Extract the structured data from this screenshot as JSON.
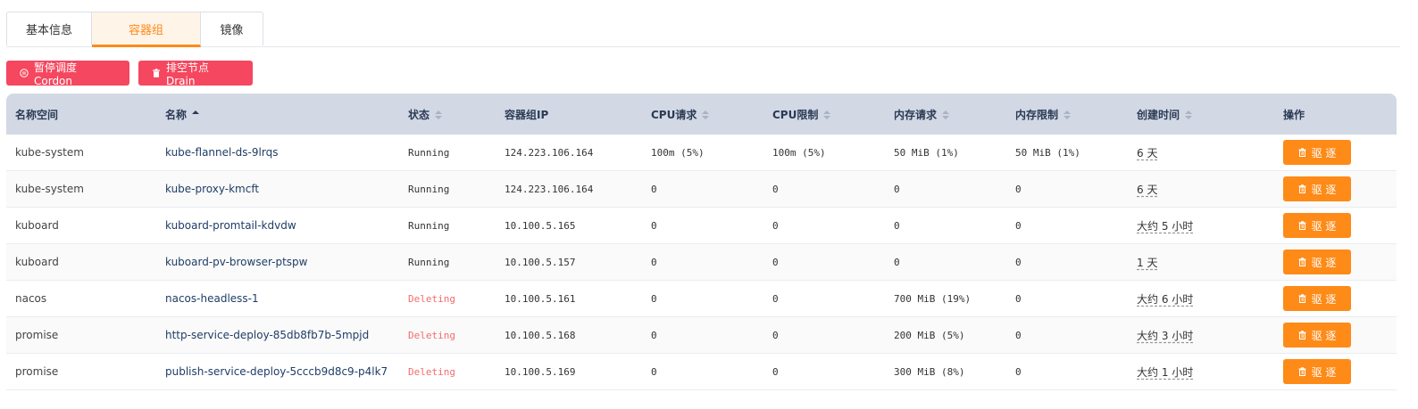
{
  "tabs": [
    "基本信息",
    "容器组",
    "镜像"
  ],
  "actions": {
    "cordon_label": "暂停调度 Cordon",
    "drain_label": "排空节点 Drain"
  },
  "colors": {
    "accent": "#fe8a18",
    "danger": "#f5475f",
    "header_bg": "#d2d9e5"
  },
  "table": {
    "headers": [
      "名称空间",
      "名称",
      "状态",
      "容器组IP",
      "CPU请求",
      "CPU限制",
      "内存请求",
      "内存限制",
      "创建时间",
      "操作"
    ],
    "evict_label": "驱 逐",
    "rows": [
      {
        "ns": "kube-system",
        "name": "kube-flannel-ds-9lrqs",
        "status": "Running",
        "ip": "124.223.106.164",
        "cpu_req": "100m (5%)",
        "cpu_lim": "100m (5%)",
        "mem_req": "50 MiB (1%)",
        "mem_lim": "50 MiB (1%)",
        "created": "6 天"
      },
      {
        "ns": "kube-system",
        "name": "kube-proxy-kmcft",
        "status": "Running",
        "ip": "124.223.106.164",
        "cpu_req": "0",
        "cpu_lim": "0",
        "mem_req": "0",
        "mem_lim": "0",
        "created": "6 天"
      },
      {
        "ns": "kuboard",
        "name": "kuboard-promtail-kdvdw",
        "status": "Running",
        "ip": "10.100.5.165",
        "cpu_req": "0",
        "cpu_lim": "0",
        "mem_req": "0",
        "mem_lim": "0",
        "created": "大约 5 小时"
      },
      {
        "ns": "kuboard",
        "name": "kuboard-pv-browser-ptspw",
        "status": "Running",
        "ip": "10.100.5.157",
        "cpu_req": "0",
        "cpu_lim": "0",
        "mem_req": "0",
        "mem_lim": "0",
        "created": "1 天"
      },
      {
        "ns": "nacos",
        "name": "nacos-headless-1",
        "status": "Deleting",
        "ip": "10.100.5.161",
        "cpu_req": "0",
        "cpu_lim": "0",
        "mem_req": "700 MiB (19%)",
        "mem_lim": "0",
        "created": "大约 6 小时"
      },
      {
        "ns": "promise",
        "name": "http-service-deploy-85db8fb7b-5mpjd",
        "status": "Deleting",
        "ip": "10.100.5.168",
        "cpu_req": "0",
        "cpu_lim": "0",
        "mem_req": "200 MiB (5%)",
        "mem_lim": "0",
        "created": "大约 3 小时"
      },
      {
        "ns": "promise",
        "name": "publish-service-deploy-5cccb9d8c9-p4lk7",
        "status": "Deleting",
        "ip": "10.100.5.169",
        "cpu_req": "0",
        "cpu_lim": "0",
        "mem_req": "300 MiB (8%)",
        "mem_lim": "0",
        "created": "大约 1 小时"
      }
    ]
  }
}
